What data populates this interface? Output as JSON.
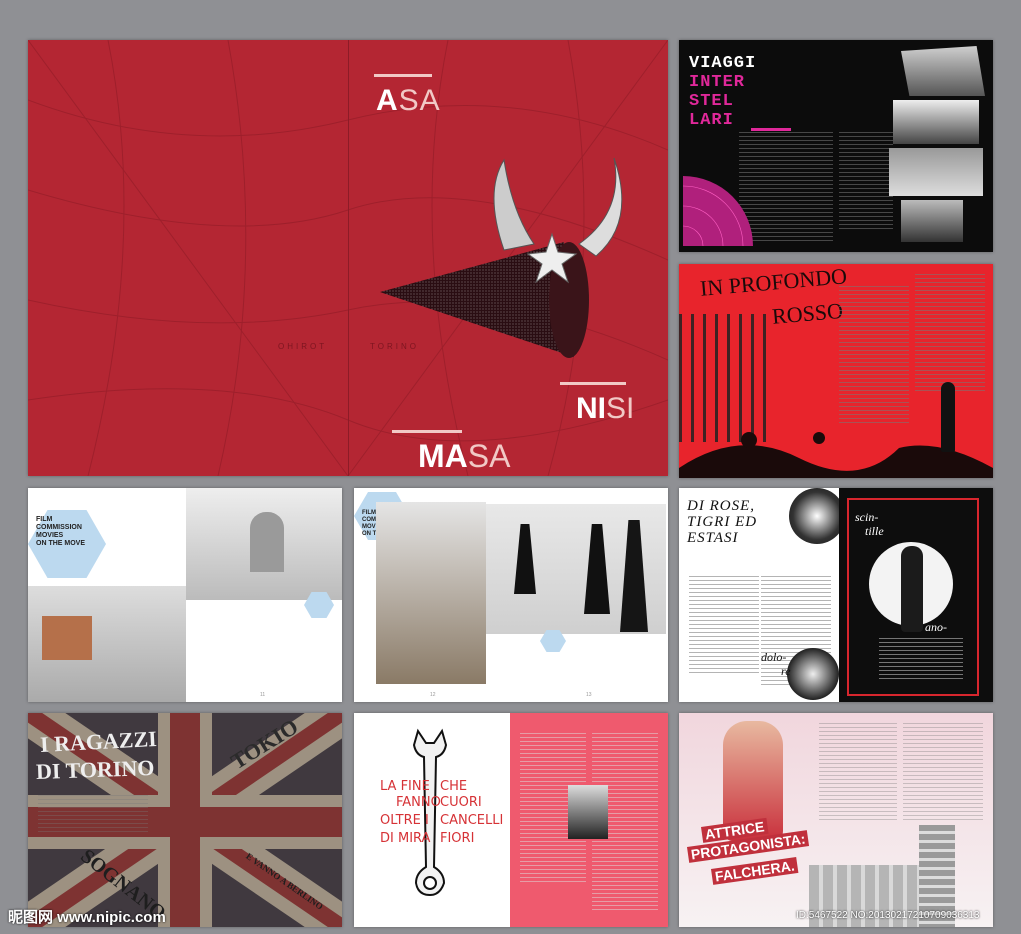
{
  "cover": {
    "word_top_bold": "A",
    "word_top_rest": "SA",
    "word_mid_bold": "NI",
    "word_mid_rest": "SI",
    "word_bottom_bold": "MA",
    "word_bottom_rest": "SA",
    "map_label_left": "OHIROT",
    "map_label_right": "TORINO"
  },
  "viaggi": {
    "title_white": "VIAGGI",
    "title_pink_1": "INTER",
    "title_pink_2": "STEL",
    "title_pink_3": "LARI"
  },
  "rosso": {
    "title_1": "IN PROFONDO",
    "title_2": "ROSSO"
  },
  "film_left": {
    "line_1": "FILM",
    "line_2": "COMMISSION",
    "line_3": "MOVIES",
    "line_4": "ON THE MOVE",
    "page_no": "11"
  },
  "film_right": {
    "line_1": "FILM",
    "line_2": "COMMISSION",
    "line_3": "MOVIES",
    "line_4": "ON THE MOVE",
    "page_left": "12",
    "page_right": "13"
  },
  "rose": {
    "title_1": "DI ROSE,",
    "title_2": "TIGRI ED",
    "title_3": "ESTASI",
    "script_1": "scin-",
    "script_2": "tille",
    "script_3": "ano-",
    "script_4": "dolo-",
    "script_5": "re"
  },
  "ragazzi": {
    "title_1": "I RAGAZZI",
    "title_2": "DI TORINO",
    "tokio": "TOKIO",
    "sognano": "SOGNANO",
    "berlino": "E VANNO A BERLINO"
  },
  "fine": {
    "left_1": "LA FINE",
    "left_2": "FANNO",
    "left_3": "OLTRE I",
    "left_4": "DI MIRA",
    "right_1": "CHE",
    "right_2": "CUORI",
    "right_3": "CANCELLI",
    "right_4": "FIORI"
  },
  "attrice": {
    "line_1": "ATTRICE",
    "line_2": "PROTAGONISTA:",
    "line_3": "FALCHERA."
  },
  "watermark": {
    "site": "昵图网 www.nipic.com",
    "id": "ID:5467522 NO:20130217210709036313"
  },
  "colors": {
    "cover_red": "#b42633",
    "rosso_red": "#e8242c",
    "viaggi_pink": "#e0289a",
    "fine_pink": "#ef5a6e",
    "film_blue": "#bcd9ef"
  }
}
